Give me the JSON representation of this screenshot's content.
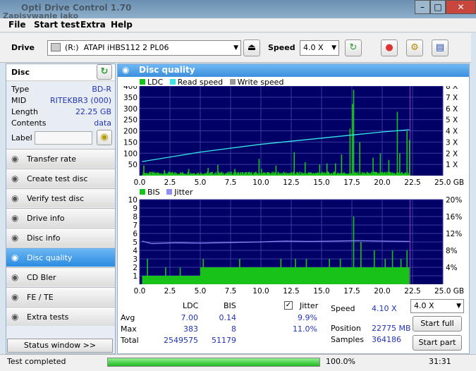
{
  "window": {
    "title": "Opti Drive Control 1.70",
    "subtitle": "Zapisywanie jako"
  },
  "menu": [
    "File",
    "Start test",
    "Extra",
    "Help"
  ],
  "toolbar": {
    "drive_label": "Drive",
    "drive_letter": "(R:)",
    "drive_value": "ATAPI iHBS112  2 PL06",
    "speed_label": "Speed",
    "speed_value": "4.0 X"
  },
  "disc": {
    "header": "Disc",
    "rows": [
      {
        "key": "Type",
        "value": "BD-R"
      },
      {
        "key": "MID",
        "value": "RITEKBR3 (000)"
      },
      {
        "key": "Length",
        "value": "22.25 GB"
      },
      {
        "key": "Contents",
        "value": "data"
      }
    ],
    "label_key": "Label"
  },
  "nav": [
    {
      "label": "Transfer rate",
      "active": false
    },
    {
      "label": "Create test disc",
      "active": false
    },
    {
      "label": "Verify test disc",
      "active": false
    },
    {
      "label": "Drive info",
      "active": false
    },
    {
      "label": "Disc info",
      "active": false
    },
    {
      "label": "Disc quality",
      "active": true
    },
    {
      "label": "CD Bler",
      "active": false
    },
    {
      "label": "FE / TE",
      "active": false
    },
    {
      "label": "Extra tests",
      "active": false
    }
  ],
  "status_window_button": "Status window >>",
  "panel": {
    "title": "Disc quality"
  },
  "legend_top": {
    "ldc": "LDC",
    "read": "Read speed",
    "write": "Write speed"
  },
  "legend_bottom": {
    "bis": "BIS",
    "jitter": "Jitter"
  },
  "colors": {
    "ldc": "#19c219",
    "read": "#36e6ea",
    "write": "#9a9a9a",
    "bis": "#19c219",
    "jitter": "#8f8fff",
    "plot_bg": "#000066",
    "accent": "#2a8be0"
  },
  "stats": {
    "col_ldc": "LDC",
    "col_bis": "BIS",
    "col_jitter": "Jitter",
    "rows": [
      {
        "label": "Avg",
        "ldc": "7.00",
        "bis": "0.14",
        "jitter": "9.9%"
      },
      {
        "label": "Max",
        "ldc": "383",
        "bis": "8",
        "jitter": "11.0%"
      },
      {
        "label": "Total",
        "ldc": "2549575",
        "bis": "51179",
        "jitter": ""
      }
    ],
    "speed_label": "Speed",
    "speed_value": "4.10 X",
    "position_label": "Position",
    "position_value": "22775 MB",
    "samples_label": "Samples",
    "samples_value": "364186",
    "speed_select": "4.0 X",
    "start_full": "Start full",
    "start_part": "Start part"
  },
  "status": {
    "text": "Test completed",
    "progress_pct": 100,
    "progress_label": "100.0%",
    "time": "31:31"
  },
  "chart_data": [
    {
      "type": "bar",
      "title": "",
      "x_ticks": [
        "0.0",
        "2.5",
        "5.0",
        "7.5",
        "10.0",
        "12.5",
        "15.0",
        "17.5",
        "20.0",
        "22.5",
        "25.0 GB"
      ],
      "xlim": [
        0,
        25
      ],
      "y_ticks_left": [
        50,
        100,
        150,
        200,
        250,
        300,
        350,
        400
      ],
      "ylim": [
        0,
        400
      ],
      "y_ticks_right": [
        "1 X",
        "2 X",
        "3 X",
        "4 X",
        "5 X",
        "6 X",
        "7 X",
        "8 X"
      ],
      "y2lim": [
        0,
        8
      ],
      "series": [
        {
          "name": "LDC",
          "color": "#19c219",
          "baseline": 12,
          "spikes": [
            [
              0.3,
              45
            ],
            [
              2.0,
              25
            ],
            [
              4.0,
              30
            ],
            [
              5.6,
              35
            ],
            [
              6.4,
              48
            ],
            [
              7.8,
              30
            ],
            [
              9.8,
              75
            ],
            [
              10.0,
              30
            ],
            [
              11.2,
              45
            ],
            [
              12.7,
              105
            ],
            [
              13.6,
              60
            ],
            [
              14.8,
              50
            ],
            [
              15.4,
              55
            ],
            [
              16.1,
              55
            ],
            [
              16.6,
              95
            ],
            [
              17.3,
              210
            ],
            [
              17.5,
              320
            ],
            [
              17.6,
              383
            ],
            [
              18.1,
              150
            ],
            [
              19.2,
              80
            ],
            [
              19.8,
              100
            ],
            [
              20.5,
              70
            ],
            [
              21.2,
              285
            ],
            [
              21.4,
              100
            ],
            [
              22.0,
              200
            ],
            [
              22.2,
              160
            ]
          ]
        },
        {
          "name": "Read speed",
          "color": "#36e6ea",
          "line": [
            [
              0.2,
              1.25
            ],
            [
              5,
              2.1
            ],
            [
              10,
              2.8
            ],
            [
              15,
              3.35
            ],
            [
              20,
              3.9
            ],
            [
              22.25,
              4.1
            ]
          ]
        }
      ]
    },
    {
      "type": "bar",
      "x_ticks": [
        "0.0",
        "2.5",
        "5.0",
        "7.5",
        "10.0",
        "12.5",
        "15.0",
        "17.5",
        "20.0",
        "22.5",
        "25.0 GB"
      ],
      "xlim": [
        0,
        25
      ],
      "y_ticks_left": [
        1,
        2,
        3,
        4,
        5,
        6,
        7,
        8,
        9,
        10
      ],
      "ylim": [
        0,
        10
      ],
      "y_ticks_right": [
        "4%",
        "8%",
        "12%",
        "16%",
        "20%"
      ],
      "y2lim": [
        0,
        20
      ],
      "series": [
        {
          "name": "BIS",
          "color": "#19c219",
          "segments": [
            [
              0.2,
              5.0,
              1
            ],
            [
              5.0,
              22.25,
              2
            ]
          ],
          "spikes": [
            [
              0.6,
              3
            ],
            [
              2.1,
              2
            ],
            [
              3.3,
              2
            ],
            [
              5.2,
              3
            ],
            [
              6.0,
              2
            ],
            [
              7.3,
              2
            ],
            [
              8.2,
              3
            ],
            [
              9.0,
              2
            ],
            [
              10.7,
              2
            ],
            [
              11.6,
              3
            ],
            [
              12.8,
              3
            ],
            [
              13.7,
              3
            ],
            [
              14.3,
              2
            ],
            [
              15.6,
              3
            ],
            [
              16.5,
              3
            ],
            [
              17.6,
              8
            ],
            [
              18.2,
              5
            ],
            [
              19.3,
              4
            ],
            [
              20.2,
              3
            ],
            [
              20.8,
              4
            ],
            [
              21.5,
              3
            ],
            [
              22.0,
              4
            ]
          ]
        },
        {
          "name": "Jitter",
          "color": "#8f8fff",
          "line": [
            [
              0.2,
              10.2
            ],
            [
              1,
              9.6
            ],
            [
              3,
              9.8
            ],
            [
              5,
              9.7
            ],
            [
              8,
              9.9
            ],
            [
              10,
              10.0
            ],
            [
              12,
              10.2
            ],
            [
              14,
              10.1
            ],
            [
              16,
              10.2
            ],
            [
              18,
              10.3
            ],
            [
              20,
              10.2
            ],
            [
              22.25,
              10.1
            ]
          ]
        }
      ]
    }
  ]
}
